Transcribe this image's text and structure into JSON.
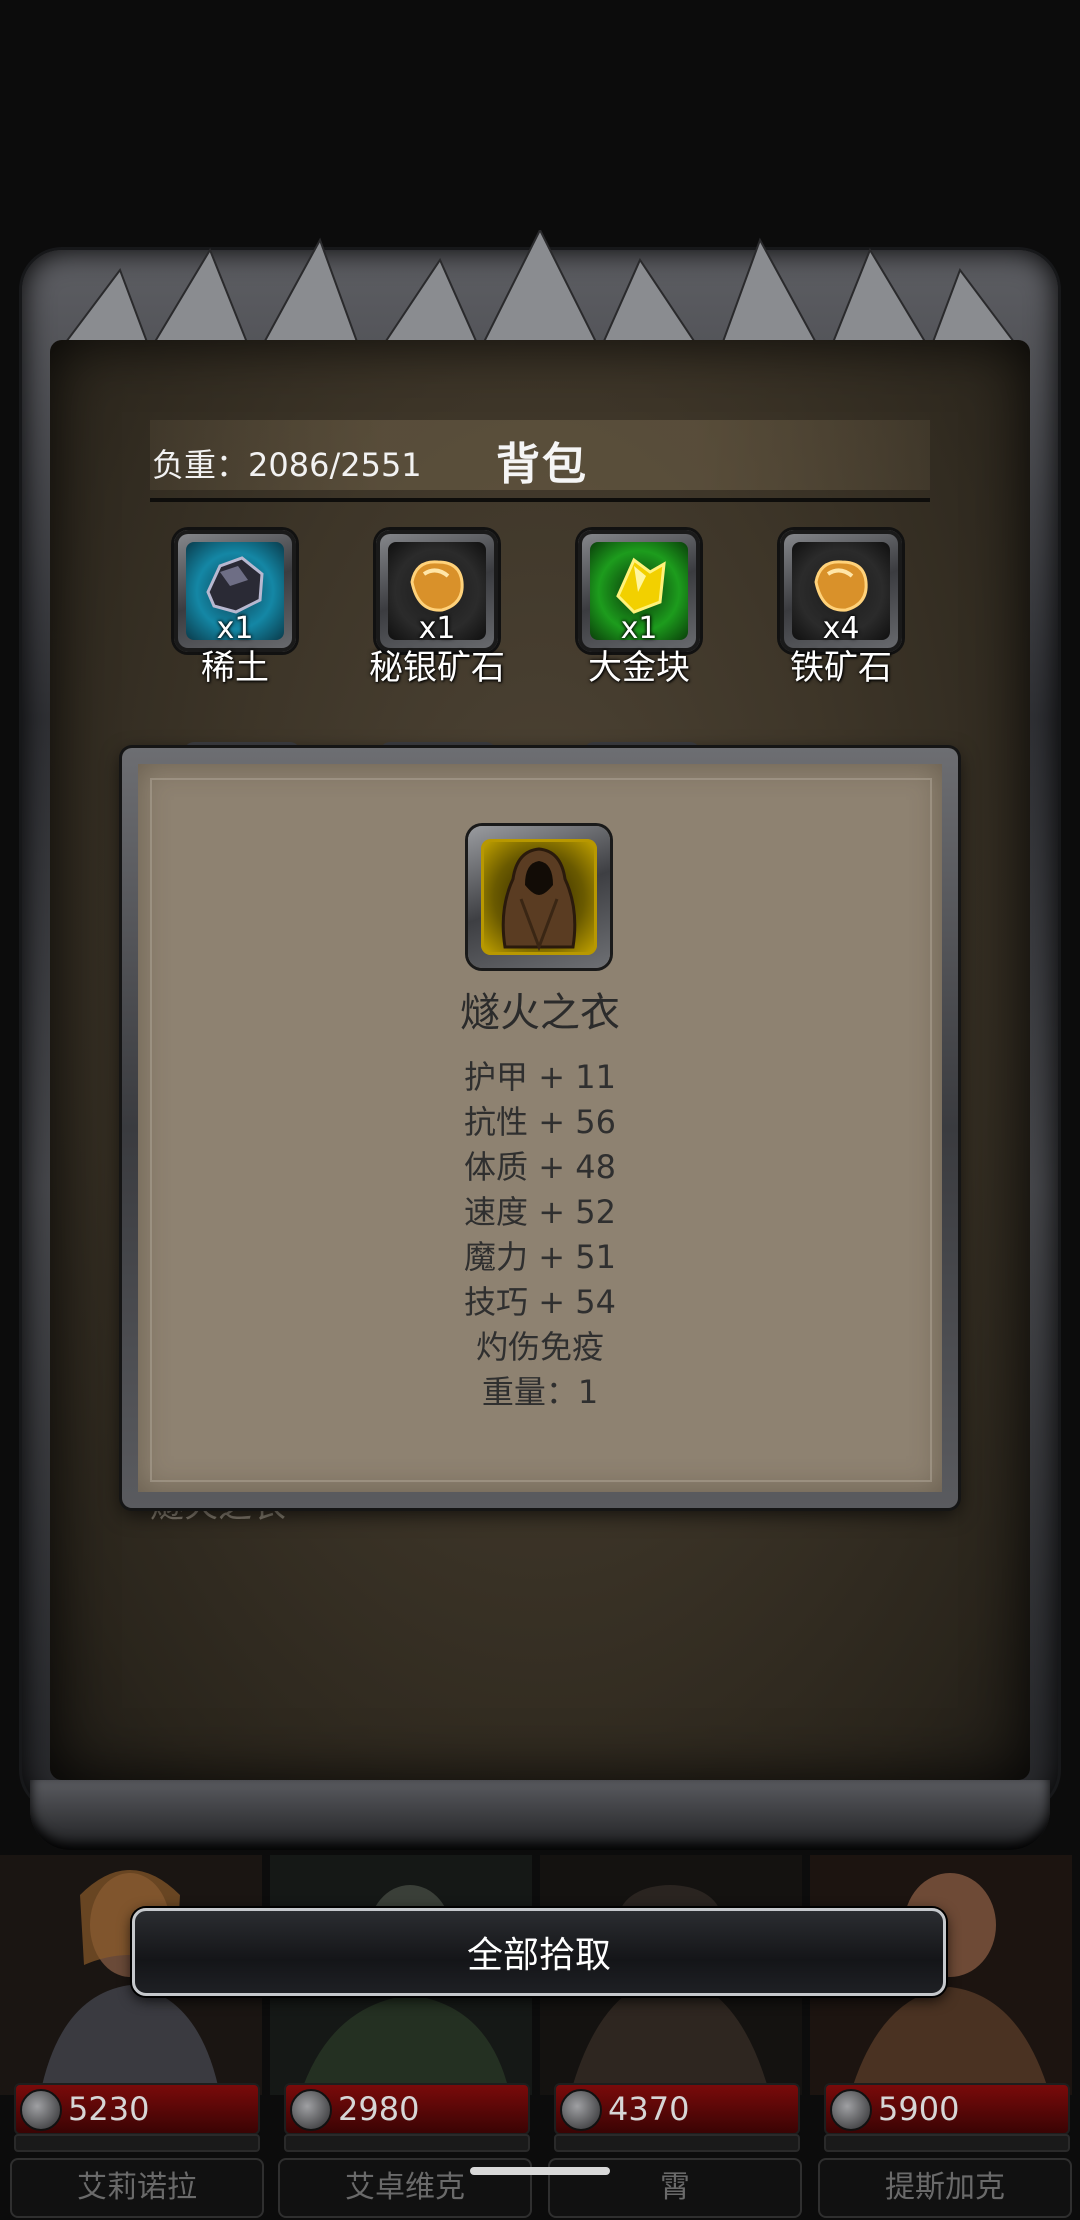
{
  "backpack": {
    "weight_label": "负重：2086/2551",
    "title": "背包",
    "items": [
      {
        "name": "稀土",
        "qty": "x1",
        "icon": "rare-earth-ore-icon",
        "rarity_color": "#1487a5"
      },
      {
        "name": "秘银矿石",
        "qty": "x1",
        "icon": "mithril-ore-icon",
        "rarity_color": "#2b2b2b"
      },
      {
        "name": "大金块",
        "qty": "x1",
        "icon": "gold-nugget-icon",
        "rarity_color": "#1d9c1d"
      },
      {
        "name": "铁矿石",
        "qty": "x4",
        "icon": "iron-ore-icon",
        "rarity_color": "#2b2b2b"
      }
    ],
    "hidden_item_label": "燧火之衣"
  },
  "tooltip": {
    "item_name": "燧火之衣",
    "icon": "hooded-cloak-icon",
    "rarity_color": "#c9a800",
    "stats": [
      "护甲 + 11",
      "抗性 + 56",
      "体质 + 48",
      "速度 + 52",
      "魔力 + 51",
      "技巧 + 54",
      "灼伤免疫",
      "重量：1"
    ]
  },
  "action": {
    "pick_all_label": "全部拾取"
  },
  "party": [
    {
      "name": "艾莉诺拉",
      "hp": "5230"
    },
    {
      "name": "艾卓维克",
      "hp": "2980"
    },
    {
      "name": "霄",
      "hp": "4370"
    },
    {
      "name": "提斯加克",
      "hp": "5900"
    }
  ]
}
